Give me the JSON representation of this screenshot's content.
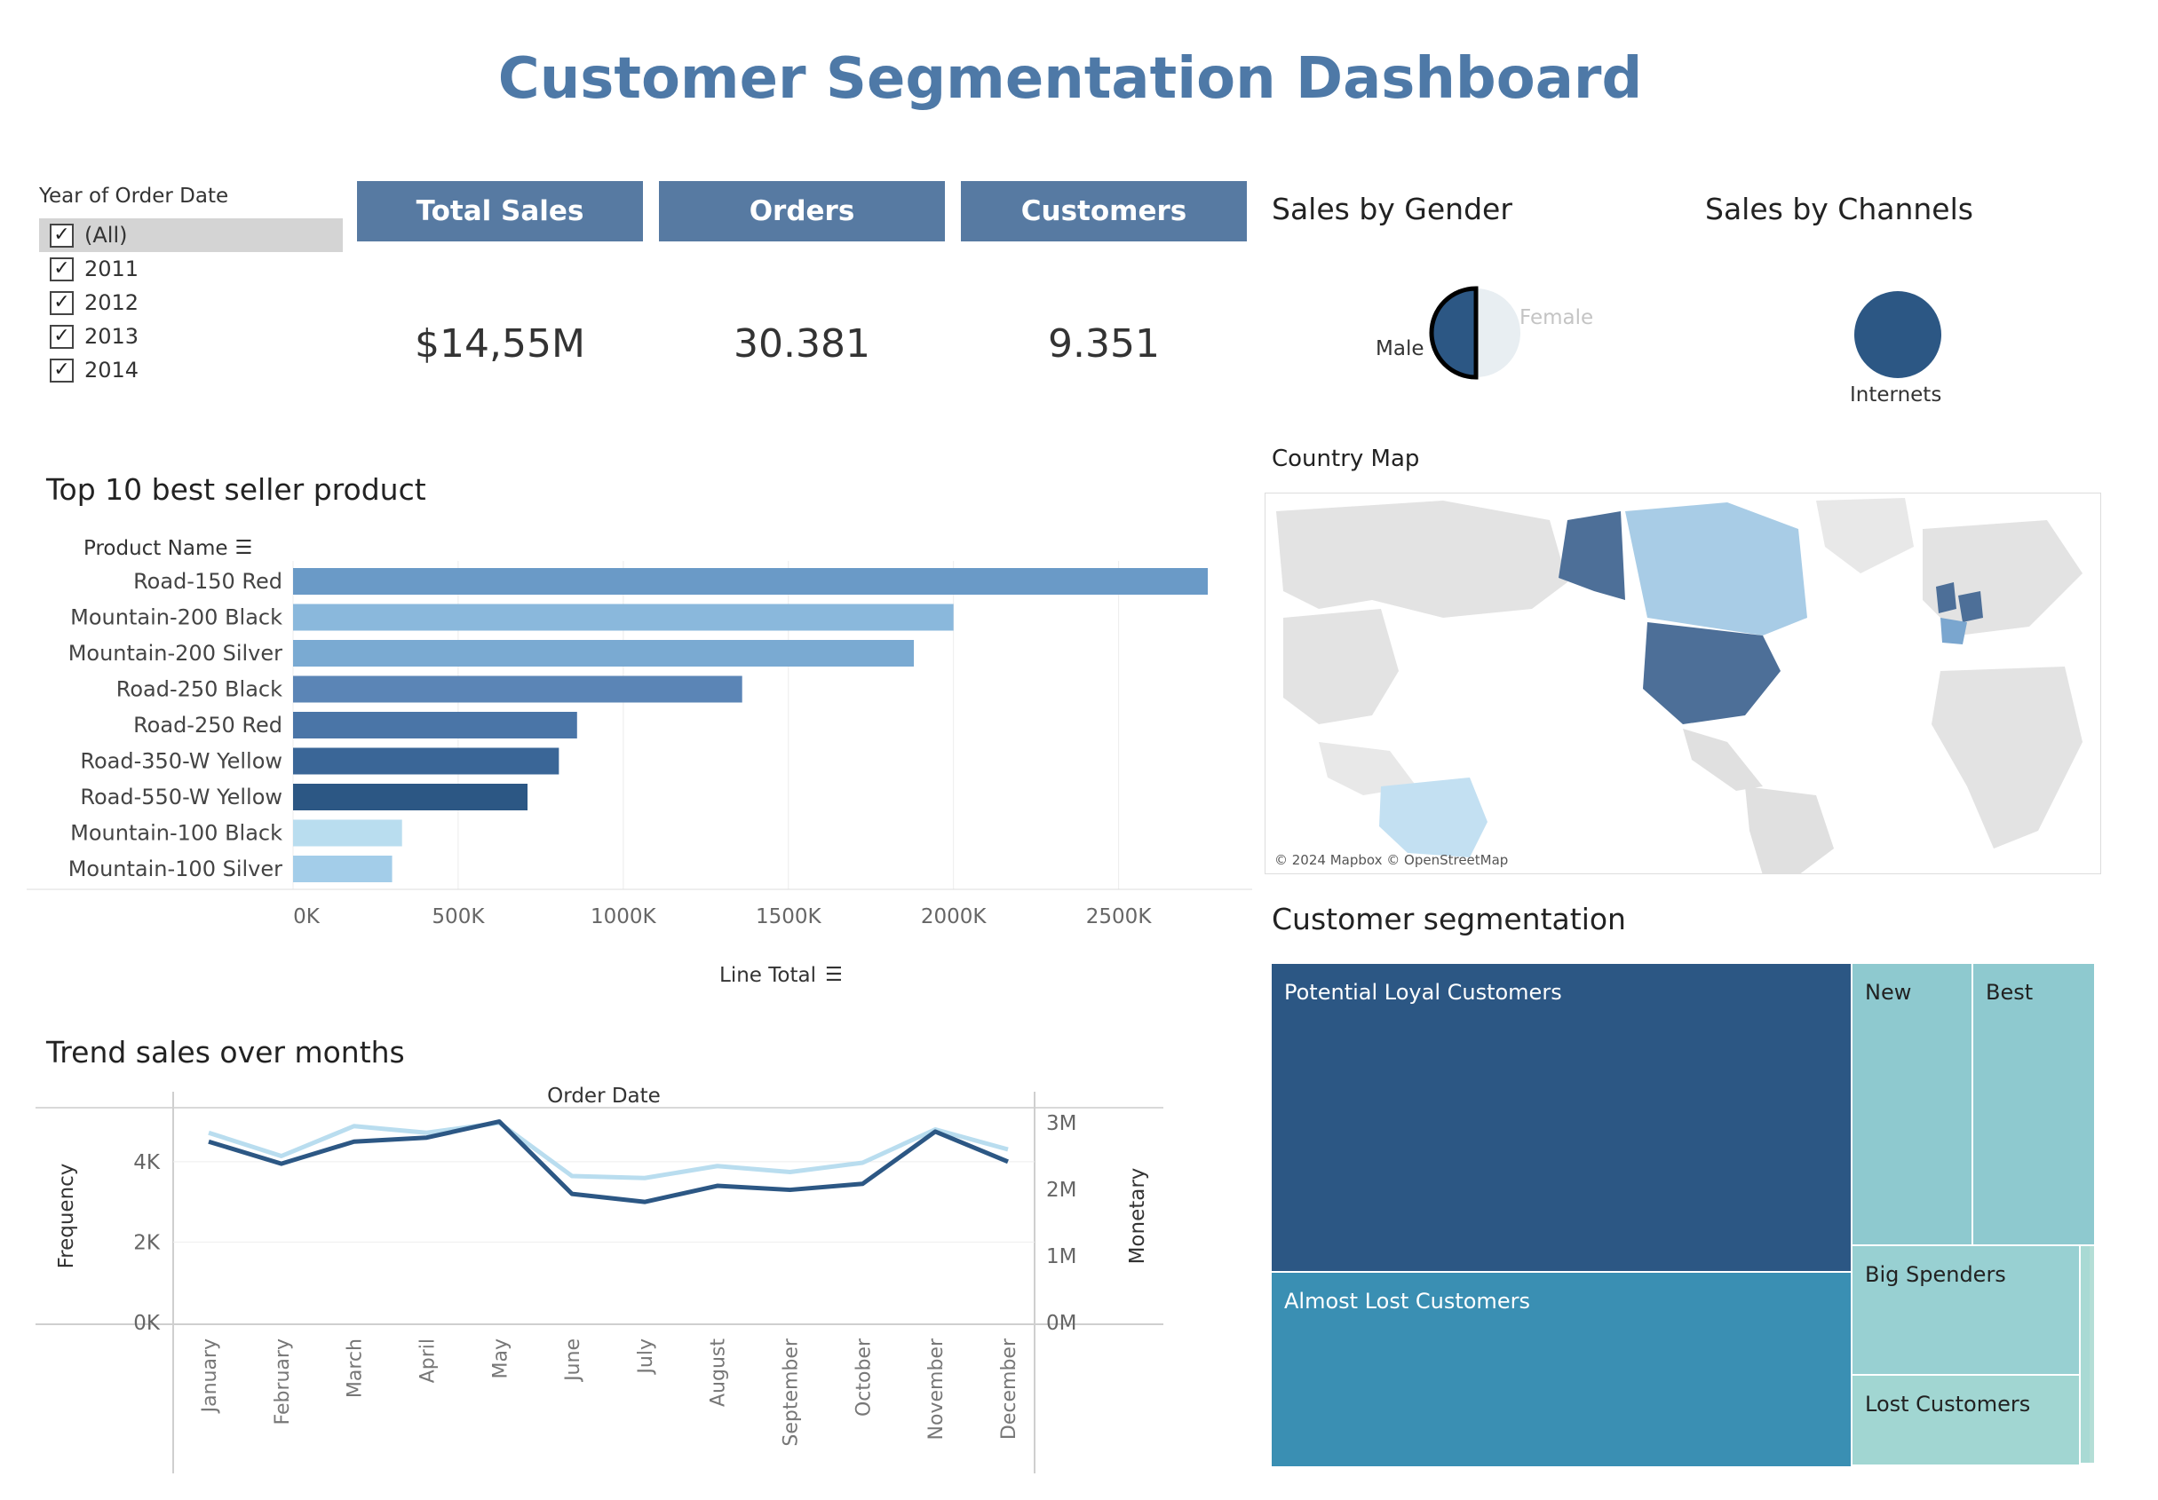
{
  "header": {
    "title": "Customer Segmentation Dashboard"
  },
  "filter": {
    "title": "Year of Order Date",
    "items": [
      {
        "label": "(All)",
        "checked": true,
        "selected": true
      },
      {
        "label": "2011",
        "checked": true
      },
      {
        "label": "2012",
        "checked": true
      },
      {
        "label": "2013",
        "checked": true
      },
      {
        "label": "2014",
        "checked": true
      }
    ]
  },
  "kpis": [
    {
      "label": "Total Sales",
      "value": "$14,55M"
    },
    {
      "label": "Orders",
      "value": "30.381"
    },
    {
      "label": "Customers",
      "value": "9.351"
    }
  ],
  "gender": {
    "title": "Sales by Gender",
    "male_label": "Male",
    "female_label": "Female",
    "male_share": 0.5,
    "colors": {
      "male": "#2c5784",
      "female": "#e8eef2"
    }
  },
  "channels": {
    "title": "Sales by Channels",
    "label": "Internets",
    "color": "#2c5784"
  },
  "map": {
    "title": "Country Map",
    "attribution": "© 2024 Mapbox © OpenStreetMap"
  },
  "top10": {
    "title": "Top 10 best seller product",
    "row_header": "Product Name",
    "axis_label": "Line Total",
    "ticks": [
      "0K",
      "500K",
      "1000K",
      "1500K",
      "2000K",
      "2500K"
    ]
  },
  "trend": {
    "title": "Trend sales over months",
    "header": "Order Date",
    "left_axis_label": "Frequency",
    "right_axis_label": "Monetary",
    "left_ticks": [
      "4K",
      "2K",
      "0K"
    ],
    "right_ticks": [
      "3M",
      "2M",
      "1M",
      "0M"
    ]
  },
  "segmentation": {
    "title": "Customer segmentation",
    "segments": [
      {
        "label": "Potential Loyal Customers",
        "color": "#2c5784",
        "text_color": "#ffffff"
      },
      {
        "label": "Almost Lost Customers",
        "color": "#3a8fb3",
        "text_color": "#ffffff"
      },
      {
        "label": "New",
        "color": "#8ec9cf",
        "text_color": "#222222"
      },
      {
        "label": "Best",
        "color": "#8ec9cf",
        "text_color": "#222222"
      },
      {
        "label": "Big Spenders",
        "color": "#98d0d2",
        "text_color": "#222222"
      },
      {
        "label": "Lost Customers",
        "color": "#a1d6d2",
        "text_color": "#222222"
      }
    ]
  },
  "chart_data": [
    {
      "type": "bar",
      "orientation": "horizontal",
      "title": "Top 10 best seller product",
      "xlabel": "Line Total",
      "ylabel": "Product Name",
      "categories": [
        "Road-150 Red",
        "Mountain-200 Black",
        "Mountain-200 Silver",
        "Road-250 Black",
        "Road-250 Red",
        "Road-350-W Yellow",
        "Road-550-W Yellow",
        "Mountain-100 Black",
        "Mountain-100 Silver"
      ],
      "values": [
        2770000,
        2000000,
        1880000,
        1360000,
        860000,
        805000,
        710000,
        330000,
        300000
      ],
      "colors": [
        "#6a9ac7",
        "#8ab8dc",
        "#7aaad2",
        "#5b85b6",
        "#4a75a7",
        "#3a6697",
        "#2c5784",
        "#b9ddef",
        "#a3cde9"
      ],
      "xlim": [
        0,
        2900000
      ],
      "grid": true
    },
    {
      "type": "line",
      "title": "Trend sales over months",
      "xlabel": "Order Date",
      "categories": [
        "January",
        "February",
        "March",
        "April",
        "May",
        "June",
        "July",
        "August",
        "September",
        "October",
        "November",
        "December"
      ],
      "series": [
        {
          "name": "Frequency",
          "axis": "left",
          "color": "#2c5784",
          "values": [
            4500,
            3950,
            4500,
            4600,
            5000,
            3200,
            3000,
            3400,
            3300,
            3450,
            4750,
            4000
          ]
        },
        {
          "name": "Monetary",
          "axis": "right",
          "color": "#b9ddef",
          "values": [
            2.85,
            2.5,
            2.95,
            2.85,
            3.0,
            2.2,
            2.17,
            2.35,
            2.26,
            2.4,
            2.9,
            2.6
          ]
        }
      ],
      "ylim_left": [
        0,
        5300
      ],
      "ylim_right": [
        0,
        3.2
      ],
      "grid": true
    }
  ]
}
